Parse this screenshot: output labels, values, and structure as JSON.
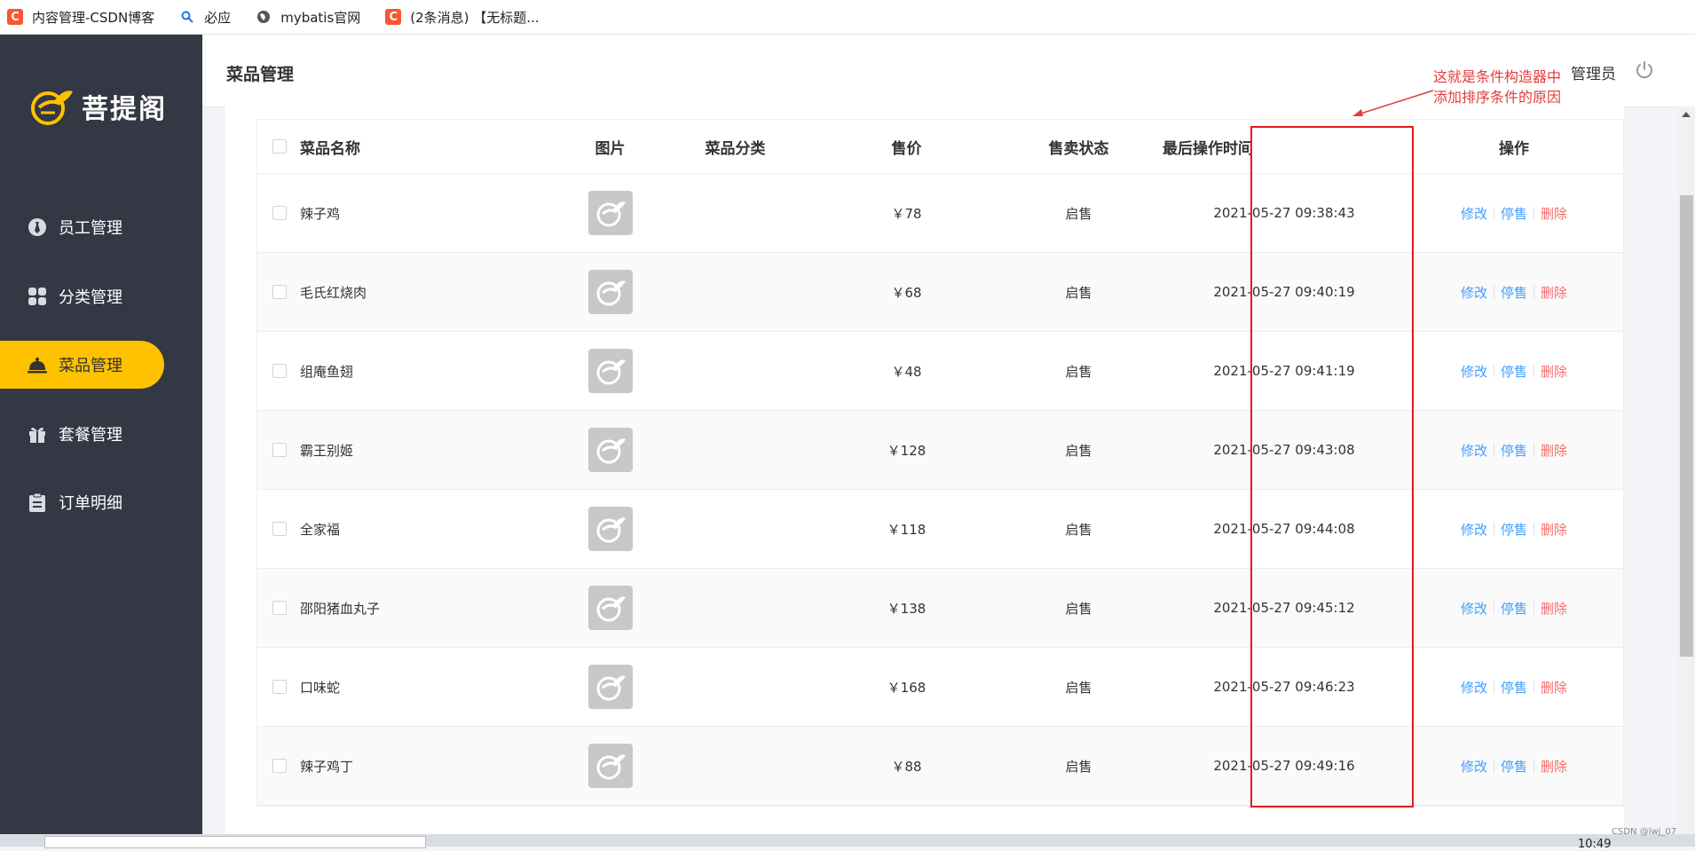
{
  "bookmarks": [
    {
      "label": "内容管理-CSDN博客",
      "icon": "csdn-icon"
    },
    {
      "label": "必应",
      "icon": "bing-search-icon"
    },
    {
      "label": "mybatis官网",
      "icon": "globe-icon"
    },
    {
      "label": "(2条消息) 【无标题...",
      "icon": "csdn-icon"
    }
  ],
  "sidebar": {
    "logo_text": "菩提阁",
    "items": [
      {
        "label": "员工管理",
        "icon": "employee-tie-icon",
        "active": false
      },
      {
        "label": "分类管理",
        "icon": "category-grid-icon",
        "active": false
      },
      {
        "label": "菜品管理",
        "icon": "dish-cloche-icon",
        "active": true
      },
      {
        "label": "套餐管理",
        "icon": "gift-package-icon",
        "active": false
      },
      {
        "label": "订单明细",
        "icon": "order-clipboard-icon",
        "active": false
      }
    ]
  },
  "header": {
    "title": "菜品管理",
    "user": "管理员",
    "logout_icon": "power-icon"
  },
  "annotation": {
    "line1": "这就是条件构造器中",
    "line2": "添加排序条件的原因",
    "color": "#e23c3c"
  },
  "table": {
    "columns": {
      "name": "菜品名称",
      "image": "图片",
      "category": "菜品分类",
      "price": "售价",
      "status": "售卖状态",
      "time": "最后操作时间",
      "ops": "操作"
    },
    "ops": {
      "edit": "修改",
      "stop": "停售",
      "delete": "删除"
    },
    "rows": [
      {
        "name": "辣子鸡",
        "category": "",
        "price": "￥78",
        "status": "启售",
        "time": "2021-05-27 09:38:43"
      },
      {
        "name": "毛氏红烧肉",
        "category": "",
        "price": "￥68",
        "status": "启售",
        "time": "2021-05-27 09:40:19"
      },
      {
        "name": "组庵鱼翅",
        "category": "",
        "price": "￥48",
        "status": "启售",
        "time": "2021-05-27 09:41:19"
      },
      {
        "name": "霸王别姬",
        "category": "",
        "price": "￥128",
        "status": "启售",
        "time": "2021-05-27 09:43:08"
      },
      {
        "name": "全家福",
        "category": "",
        "price": "￥118",
        "status": "启售",
        "time": "2021-05-27 09:44:08"
      },
      {
        "name": "邵阳猪血丸子",
        "category": "",
        "price": "￥138",
        "status": "启售",
        "time": "2021-05-27 09:45:12"
      },
      {
        "name": "口味蛇",
        "category": "",
        "price": "￥168",
        "status": "启售",
        "time": "2021-05-27 09:46:23"
      },
      {
        "name": "辣子鸡丁",
        "category": "",
        "price": "￥88",
        "status": "启售",
        "time": "2021-05-27 09:49:16"
      }
    ]
  },
  "watermark": "CSDN @lwj_07",
  "clock": "10:49",
  "colors": {
    "sidebar_bg": "#343744",
    "accent": "#ffc200",
    "link": "#419eff",
    "danger": "#f56c6c"
  }
}
